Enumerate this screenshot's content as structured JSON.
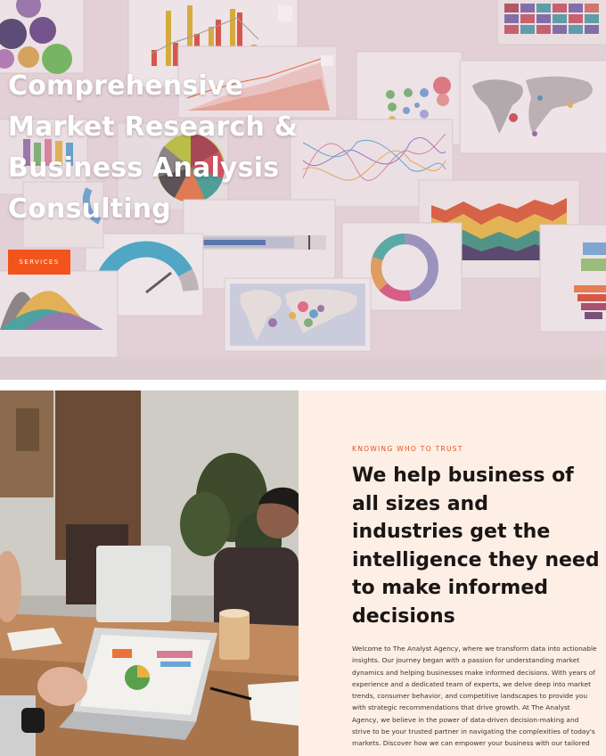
{
  "hero": {
    "title_lines": [
      "Comprehensive",
      "Market Research &",
      "Business Analysis",
      "Consulting"
    ],
    "services_label": "SERVICES",
    "colors": {
      "accent": "#f2541b",
      "title": "#ffffff"
    }
  },
  "about": {
    "eyebrow": "KNOWING WHO TO TRUST",
    "heading_lines": [
      "We help business of",
      "all sizes and",
      "industries get the",
      "intelligence they need",
      "to make informed",
      "decisions"
    ],
    "body_lines": [
      "Welcome to The Analyst Agency, where we transform data into actionable",
      "insights. Our journey began with a passion for understanding market",
      "dynamics and helping businesses make informed decisions. With years of",
      "experience and a dedicated team of experts, we delve deep into market",
      "trends, consumer behavior, and competitive landscapes to provide you",
      "with strategic recommendations that drive growth. At The Analyst",
      "Agency, we believe in the power of data-driven decision-making and",
      "strive to be your trusted partner in navigating the complexities of today's",
      "markets. Discover how we can empower your business with our tailored"
    ],
    "colors": {
      "background": "#fdefe6",
      "eyebrow": "#e2531c",
      "heading": "#1b1514"
    }
  }
}
